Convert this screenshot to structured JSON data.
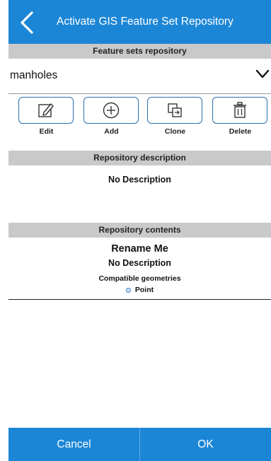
{
  "header": {
    "title": "Activate GIS Feature Set Repository"
  },
  "repository": {
    "section_title": "Feature sets repository",
    "selected": "manholes"
  },
  "toolbar": {
    "edit_label": "Edit",
    "add_label": "Add",
    "clone_label": "Clone",
    "delete_label": "Delete"
  },
  "description": {
    "section_title": "Repository description",
    "text": "No Description"
  },
  "contents": {
    "section_title": "Repository contents",
    "name": "Rename Me",
    "description": "No Description",
    "geometries_title": "Compatible geometries",
    "geometries": [
      "Point"
    ]
  },
  "footer": {
    "cancel_label": "Cancel",
    "ok_label": "OK"
  },
  "colors": {
    "accent": "#1c86d6",
    "section_header": "#c9c9c9",
    "button_border": "#2a6fb0"
  },
  "icons": {
    "back": "chevron-left-icon",
    "dropdown": "chevron-down-icon",
    "edit": "edit-icon",
    "add": "add-circle-icon",
    "clone": "clone-icon",
    "delete": "trash-icon"
  }
}
